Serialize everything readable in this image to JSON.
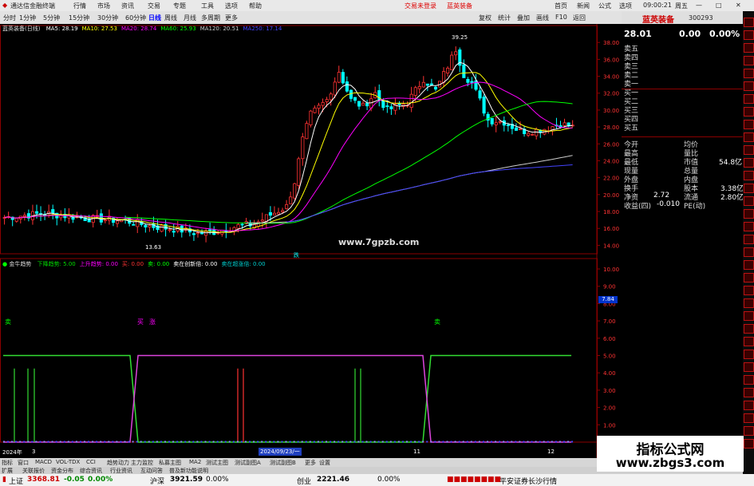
{
  "app": {
    "title": "通达信金融终端",
    "menu": [
      "行情",
      "市场",
      "资讯",
      "交易",
      "专题",
      "工具",
      "选项",
      "帮助"
    ],
    "login_notice": "交易未登录",
    "stock_tab": "蓝英装备",
    "top_right": [
      "首页",
      "新闻",
      "公式",
      "选项"
    ],
    "time": "09:00:21",
    "weekday": "周五"
  },
  "toolbar": {
    "periods": [
      "分时",
      "1分钟",
      "5分钟",
      "15分钟",
      "30分钟",
      "60分钟",
      "日线",
      "周线",
      "月线",
      "多周期",
      "更多"
    ],
    "active_period": "日线",
    "tools": [
      "复权",
      "统计",
      "叠加",
      "画线",
      "F10",
      "返回"
    ]
  },
  "main_chart": {
    "title": "蓝英装备(日线)",
    "ma_labels": [
      {
        "text": "MA5: 28.19",
        "color": "#ffffff"
      },
      {
        "text": "MA10: 27.53",
        "color": "#ffff00"
      },
      {
        "text": "MA20: 28.74",
        "color": "#ff00ff"
      },
      {
        "text": "MA60: 25.93",
        "color": "#00ff00"
      },
      {
        "text": "MA120: 20.51",
        "color": "#cccccc"
      },
      {
        "text": "MA250: 17.14",
        "color": "#4444ff"
      }
    ],
    "high_label": "39.25",
    "low_label": "13.63",
    "event_label": "跌",
    "watermark": "www.7gpzb.com",
    "y_ticks": [
      "38.00",
      "36.00",
      "34.00",
      "32.00",
      "30.00",
      "28.00",
      "26.00",
      "24.00",
      "22.00",
      "20.00",
      "18.00",
      "16.00",
      "14.00"
    ]
  },
  "indicator": {
    "title": "金牛趋势",
    "labels": [
      {
        "text": "下降趋势: 5.00",
        "color": "#00dd00"
      },
      {
        "text": "上升趋势: 0.00",
        "color": "#ff00ff"
      },
      {
        "text": "买: 0.00",
        "color": "#ff3333"
      },
      {
        "text": "卖: 0.00",
        "color": "#00ff00"
      },
      {
        "text": "卖在创新倍: 0.00",
        "color": "#ffffff"
      },
      {
        "text": "卖在超涨倍: 0.00",
        "color": "#00cccc"
      }
    ],
    "signal_labels": [
      {
        "text": "卖",
        "color": "#00ff00"
      },
      {
        "text": "买",
        "color": "#ff00ff"
      },
      {
        "text": "涨",
        "color": "#ff00ff"
      },
      {
        "text": "卖",
        "color": "#00ff00"
      }
    ],
    "current_value": "7.84",
    "y_ticks": [
      "10.00",
      "9.00",
      "8.00",
      "7.00",
      "6.00",
      "5.00",
      "4.00",
      "3.00",
      "2.00",
      "1.00"
    ]
  },
  "date_axis": [
    "2024年",
    "3",
    "2024/09/23/一",
    "11",
    "12"
  ],
  "quote": {
    "name": "蓝英装备",
    "code": "300293",
    "price": "28.01",
    "change": "0.00",
    "change_pct": "0.00%",
    "orders": [
      "卖五",
      "卖四",
      "卖三",
      "卖二",
      "卖一",
      "买一",
      "买二",
      "买三",
      "买四",
      "买五"
    ],
    "stats_left": [
      "今开",
      "最高",
      "最低",
      "现量",
      "外盘",
      "换手",
      "净资",
      "收益(四)"
    ],
    "stats_right": [
      "均价",
      "量比",
      "市值",
      "总量",
      "内盘",
      "股本",
      "流通",
      "PE(动)"
    ],
    "stats_values": [
      {
        "label": "市值",
        "value": "54.8亿"
      },
      {
        "label": "股本",
        "value": "3.38亿"
      },
      {
        "label": "净资",
        "value": "2.72"
      },
      {
        "label": "流通",
        "value": "2.80亿"
      },
      {
        "label": "收益(四)",
        "value": "-0.010"
      }
    ]
  },
  "bottom_tabs": [
    "指标",
    "窗口",
    "MACD",
    "VOL-TDX",
    "CCI",
    "趋势动力",
    "主力监控",
    "私募主图",
    "MA2",
    "测试主图",
    "测试副图A",
    "测试副图B",
    "更多",
    "设置"
  ],
  "bottom_tabs2": [
    "扩展",
    "关联报价",
    "资金分布",
    "综合资讯",
    "行业资讯",
    "互动问答",
    "普及新功能说明"
  ],
  "status": {
    "sh_name": "上证",
    "sh_value": "3368.81",
    "sh_change": "-0.05",
    "sh_pct": "0.00%",
    "sz_name": "沪深",
    "sz_value": "3921.59",
    "sz_pct": "0.00%",
    "cy_name": "创业",
    "cy_value": "2221.46",
    "cy_pct": "0.00%",
    "broker": "平安证券长沙行情"
  },
  "watermark_box": {
    "line1": "指标公式网",
    "line2": "www.zbgs3.com"
  },
  "colors": {
    "up": "#ff3333",
    "down": "#00ffff",
    "grid": "#8b0000",
    "bg": "#000000"
  }
}
